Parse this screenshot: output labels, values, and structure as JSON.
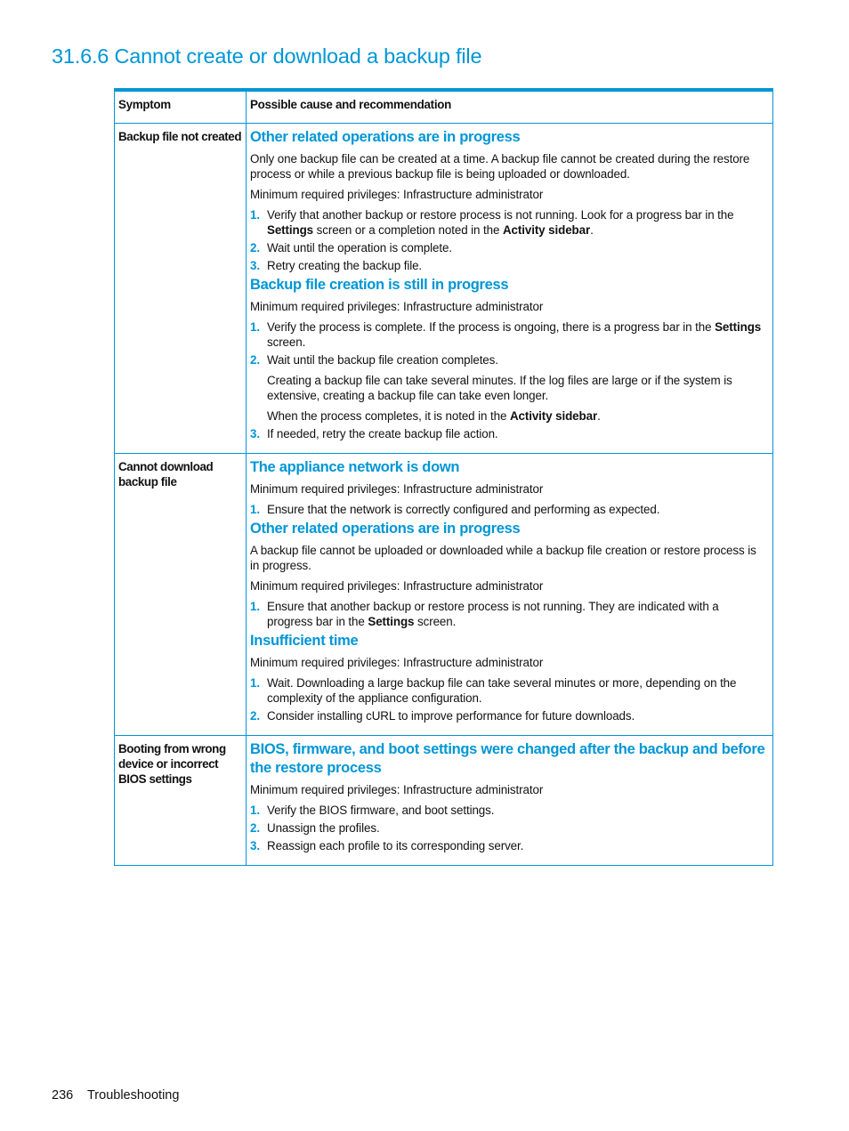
{
  "page": {
    "title": "31.6.6 Cannot create or download a backup file",
    "footer": {
      "page_number": "236",
      "section": "Troubleshooting"
    },
    "accent_color": "#0096d6"
  },
  "table": {
    "headers": [
      "Symptom",
      "Possible cause and recommendation"
    ],
    "rows": [
      {
        "symptom": "Backup file not created",
        "causes": [
          {
            "title": "Other related operations are in progress",
            "paragraphs": [
              "Only one backup file can be created at a time. A backup file cannot be created during the restore process or while a previous backup file is being uploaded or downloaded.",
              "Minimum required privileges: Infrastructure administrator"
            ],
            "steps": [
              {
                "num": "1.",
                "segments": [
                  {
                    "t": "Verify that another backup or restore process is not running. Look for a progress bar in the "
                  },
                  {
                    "t": "Settings",
                    "b": true
                  },
                  {
                    "t": " screen or a completion noted in the "
                  },
                  {
                    "t": "Activity sidebar",
                    "b": true
                  },
                  {
                    "t": "."
                  }
                ]
              },
              {
                "num": "2.",
                "segments": [
                  {
                    "t": "Wait until the operation is complete."
                  }
                ]
              },
              {
                "num": "3.",
                "segments": [
                  {
                    "t": "Retry creating the backup file."
                  }
                ]
              }
            ]
          },
          {
            "title": "Backup file creation is still in progress",
            "paragraphs": [
              "Minimum required privileges: Infrastructure administrator"
            ],
            "steps": [
              {
                "num": "1.",
                "segments": [
                  {
                    "t": "Verify the process is complete. If the process is ongoing, there is a progress bar in the "
                  },
                  {
                    "t": "Settings",
                    "b": true
                  },
                  {
                    "t": " screen."
                  }
                ]
              },
              {
                "num": "2.",
                "segments": [
                  {
                    "t": "Wait until the backup file creation completes."
                  }
                ],
                "sub": [
                  [
                    {
                      "t": "Creating a backup file can take several minutes. If the log files are large or if the system is extensive, creating a backup file can take even longer."
                    }
                  ],
                  [
                    {
                      "t": "When the process completes, it is noted in the "
                    },
                    {
                      "t": "Activity sidebar",
                      "b": true
                    },
                    {
                      "t": "."
                    }
                  ]
                ]
              },
              {
                "num": "3.",
                "segments": [
                  {
                    "t": "If needed, retry the create backup file action."
                  }
                ]
              }
            ]
          }
        ]
      },
      {
        "symptom": "Cannot download backup file",
        "causes": [
          {
            "title": "The appliance network is down",
            "paragraphs": [
              "Minimum required privileges: Infrastructure administrator"
            ],
            "steps": [
              {
                "num": "1.",
                "segments": [
                  {
                    "t": "Ensure that the network is correctly configured and performing as expected."
                  }
                ]
              }
            ]
          },
          {
            "title": "Other related operations are in progress",
            "paragraphs": [
              "A backup file cannot be uploaded or downloaded while a backup file creation or restore process is in progress.",
              "Minimum required privileges: Infrastructure administrator"
            ],
            "steps": [
              {
                "num": "1.",
                "segments": [
                  {
                    "t": "Ensure that another backup or restore process is not running. They are indicated with a progress bar in the "
                  },
                  {
                    "t": "Settings",
                    "b": true
                  },
                  {
                    "t": " screen."
                  }
                ]
              }
            ]
          },
          {
            "title": "Insufficient time",
            "paragraphs": [
              "Minimum required privileges: Infrastructure administrator"
            ],
            "steps": [
              {
                "num": "1.",
                "segments": [
                  {
                    "t": "Wait. Downloading a large backup file can take several minutes or more, depending on the complexity of the appliance configuration."
                  }
                ]
              },
              {
                "num": "2.",
                "segments": [
                  {
                    "t": "Consider installing cURL to improve performance for future downloads."
                  }
                ]
              }
            ]
          }
        ]
      },
      {
        "symptom": "Booting from wrong device or incorrect BIOS settings",
        "causes": [
          {
            "title": "BIOS, firmware, and boot settings were changed after the backup and before the restore process",
            "paragraphs": [
              "Minimum required privileges: Infrastructure administrator"
            ],
            "steps": [
              {
                "num": "1.",
                "segments": [
                  {
                    "t": "Verify the BIOS firmware, and boot settings."
                  }
                ]
              },
              {
                "num": "2.",
                "segments": [
                  {
                    "t": "Unassign the profiles."
                  }
                ]
              },
              {
                "num": "3.",
                "segments": [
                  {
                    "t": "Reassign each profile to its corresponding server."
                  }
                ]
              }
            ]
          }
        ]
      }
    ]
  }
}
